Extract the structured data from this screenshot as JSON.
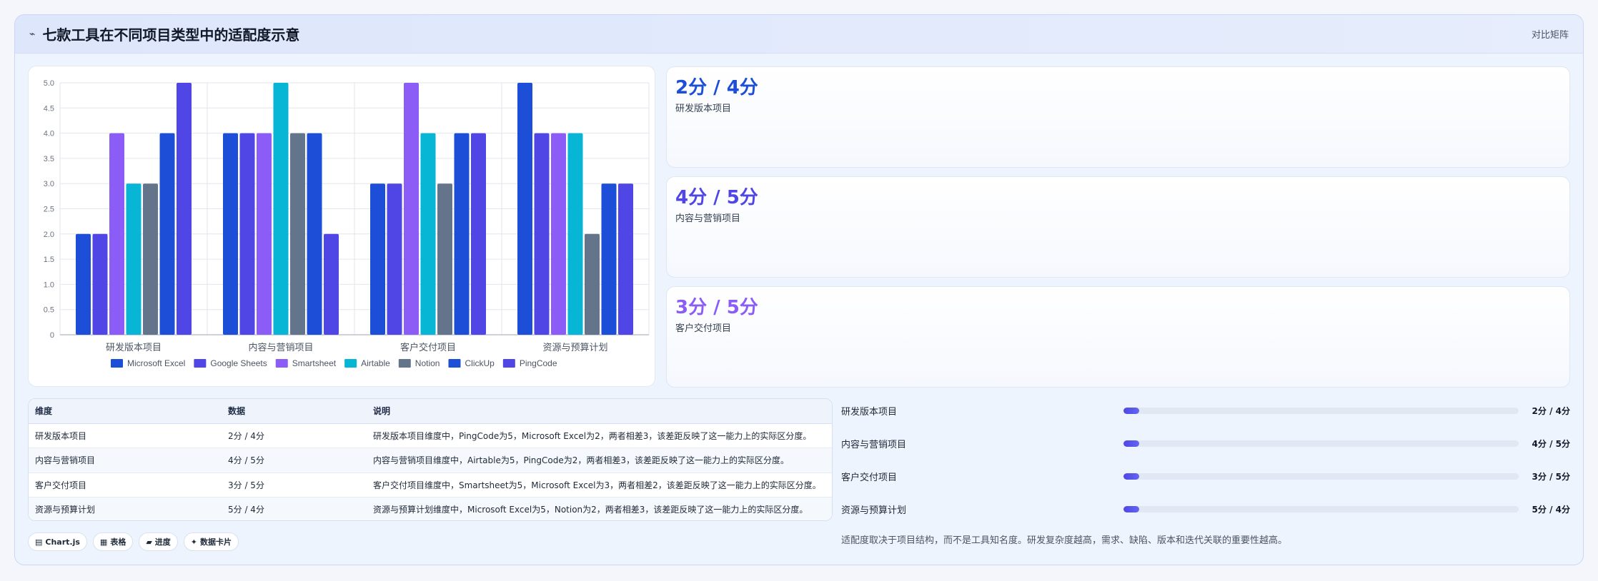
{
  "header": {
    "icon": "wave-icon",
    "title": "七款工具在不同项目类型中的适配度示意",
    "badge": "对比矩阵"
  },
  "chart_data": {
    "type": "bar",
    "categories": [
      "研发版本项目",
      "内容与营销项目",
      "客户交付项目",
      "资源与预算计划"
    ],
    "series": [
      {
        "name": "Microsoft Excel",
        "color": "#1d4ed8",
        "values": [
          2,
          4,
          3,
          5
        ]
      },
      {
        "name": "Google Sheets",
        "color": "#4f46e5",
        "values": [
          2,
          4,
          3,
          4
        ]
      },
      {
        "name": "Smartsheet",
        "color": "#8b5cf6",
        "values": [
          4,
          4,
          5,
          4
        ]
      },
      {
        "name": "Airtable",
        "color": "#06b6d4",
        "values": [
          3,
          5,
          4,
          4
        ]
      },
      {
        "name": "Notion",
        "color": "#64748b",
        "values": [
          3,
          4,
          3,
          2
        ]
      },
      {
        "name": "ClickUp",
        "color": "#1d4ed8",
        "values": [
          4,
          4,
          4,
          3
        ]
      },
      {
        "name": "PingCode",
        "color": "#4f46e5",
        "values": [
          5,
          2,
          4,
          3
        ]
      }
    ],
    "ylim": [
      0,
      5
    ],
    "yticks": [
      "0",
      "0.5",
      "1.0",
      "1.5",
      "2.0",
      "2.5",
      "3.0",
      "3.5",
      "4.0",
      "4.5",
      "5.0"
    ],
    "grid": true,
    "legend": "bottom"
  },
  "stats": [
    {
      "value": "2分 / 4分",
      "label": "研发版本项目",
      "color": "#1d4ed8"
    },
    {
      "value": "4分 / 5分",
      "label": "内容与营销项目",
      "color": "#4f46e5"
    },
    {
      "value": "3分 / 5分",
      "label": "客户交付项目",
      "color": "#8b5cf6"
    }
  ],
  "table": {
    "headers": [
      "维度",
      "数据",
      "说明"
    ],
    "rows": [
      [
        "研发版本项目",
        "2分 / 4分",
        "研发版本项目维度中，PingCode为5，Microsoft Excel为2，两者相差3，该差距反映了这一能力上的实际区分度。"
      ],
      [
        "内容与营销项目",
        "4分 / 5分",
        "内容与营销项目维度中，Airtable为5，PingCode为2，两者相差3，该差距反映了这一能力上的实际区分度。"
      ],
      [
        "客户交付项目",
        "3分 / 5分",
        "客户交付项目维度中，Smartsheet为5，Microsoft Excel为3，两者相差2，该差距反映了这一能力上的实际区分度。"
      ],
      [
        "资源与预算计划",
        "5分 / 4分",
        "资源与预算计划维度中，Microsoft Excel为5，Notion为2，两者相差3，该差距反映了这一能力上的实际区分度。"
      ]
    ]
  },
  "tags": [
    {
      "icon": "chart-icon",
      "glyph": "▤",
      "label": "Chart.js"
    },
    {
      "icon": "table-icon",
      "glyph": "▦",
      "label": "表格"
    },
    {
      "icon": "progress-icon",
      "glyph": "▰",
      "label": "进度"
    },
    {
      "icon": "card-icon",
      "glyph": "✦",
      "label": "数据卡片"
    }
  ],
  "progress": [
    {
      "label": "研发版本项目",
      "value": "2分 / 4分",
      "fraction": 0.04
    },
    {
      "label": "内容与营销项目",
      "value": "4分 / 5分",
      "fraction": 0.04
    },
    {
      "label": "客户交付项目",
      "value": "3分 / 5分",
      "fraction": 0.04
    },
    {
      "label": "资源与预算计划",
      "value": "5分 / 4分",
      "fraction": 0.04
    }
  ],
  "note": "适配度取决于项目结构，而不是工具知名度。研发复杂度越高，需求、缺陷、版本和迭代关联的重要性越高。"
}
